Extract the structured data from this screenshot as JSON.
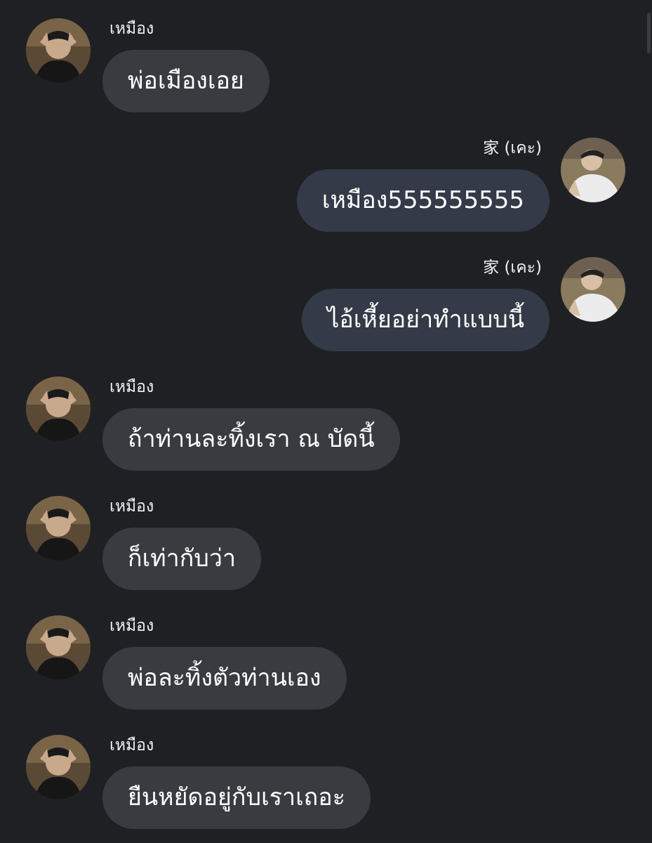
{
  "colors": {
    "background": "#1f2023",
    "incoming_bubble": "#3a3b40",
    "outgoing_bubble": "#343a47",
    "text": "#ffffff"
  },
  "messages": [
    {
      "sender": "เหมือง",
      "text": "พ่อเมืองเอย",
      "side": "left"
    },
    {
      "sender": "家 (เคะ)",
      "text": "เหมือง555555555",
      "side": "right"
    },
    {
      "sender": "家 (เคะ)",
      "text": "ไอ้เหี้ยอย่าทำแบบนี้",
      "side": "right"
    },
    {
      "sender": "เหมือง",
      "text": "ถ้าท่านละทิ้งเรา ณ บัดนี้",
      "side": "left"
    },
    {
      "sender": "เหมือง",
      "text": "ก็เท่ากับว่า",
      "side": "left"
    },
    {
      "sender": "เหมือง",
      "text": "พ่อละทิ้งตัวท่านเอง",
      "side": "left"
    },
    {
      "sender": "เหมือง",
      "text": "ยืนหยัดอยู่กับเราเถอะ",
      "side": "left"
    }
  ]
}
